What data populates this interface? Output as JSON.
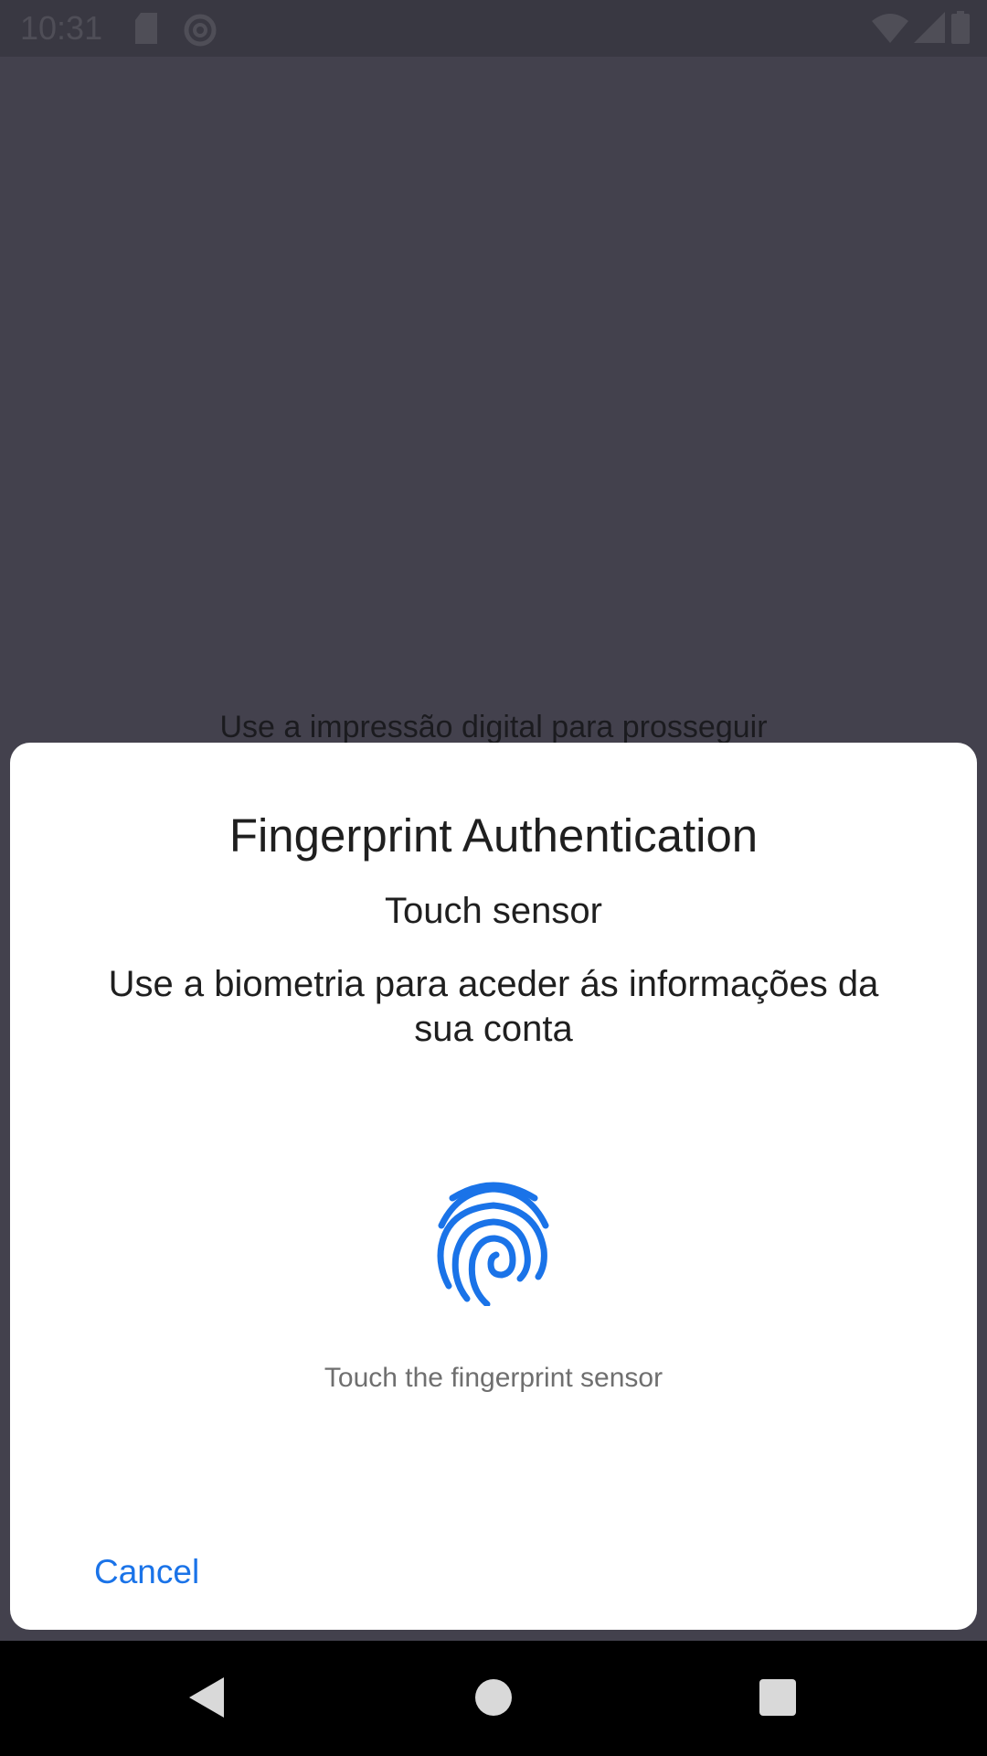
{
  "status_bar": {
    "time": "10:31",
    "icons": [
      "sd-card-icon",
      "data-saver-icon",
      "wifi-icon",
      "cell-signal-icon",
      "battery-icon"
    ]
  },
  "background": {
    "text": "Use a impressão digital para prosseguir"
  },
  "dialog": {
    "title": "Fingerprint Authentication",
    "subtitle": "Touch sensor",
    "description": "Use a biometria para aceder ás informações da sua conta",
    "icon": "fingerprint-icon",
    "help_text": "Touch the fingerprint sensor",
    "cancel_label": "Cancel"
  },
  "nav_bar": {
    "buttons": [
      "back-icon",
      "home-icon",
      "recents-icon"
    ]
  },
  "colors": {
    "scrim": "#43414d",
    "dialog_bg": "#ffffff",
    "accent": "#1a73e8",
    "nav_bg": "#000000"
  }
}
